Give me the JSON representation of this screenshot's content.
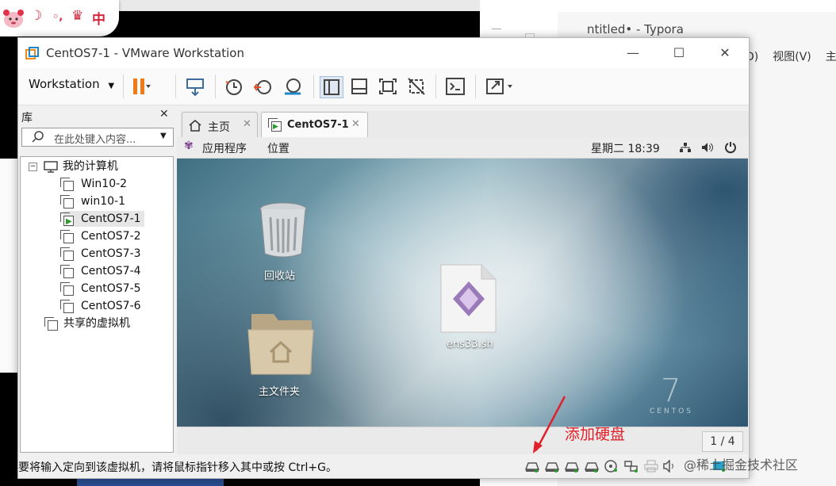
{
  "ime_bar": {
    "mode_label": "中"
  },
  "background_window": {
    "title": "ntitled• - Typora",
    "menu": [
      "D)",
      "视图(V)",
      "主题"
    ]
  },
  "window": {
    "title": "CentOS7-1 - VMware Workstation",
    "controls": {
      "minimize": "—",
      "maximize": "☐",
      "close": "✕"
    }
  },
  "toolbar": {
    "menu_label": "Workstation"
  },
  "library": {
    "title": "库",
    "close": "✕",
    "search_placeholder": "在此处键入内容...",
    "root": "我的计算机",
    "vms": [
      "Win10-2",
      "win10-1",
      "CentOS7-1",
      "CentOS7-2",
      "CentOS7-3",
      "CentOS7-4",
      "CentOS7-5",
      "CentOS7-6"
    ],
    "selected_vm": "CentOS7-1",
    "shared": "共享的虚拟机"
  },
  "tabs": [
    {
      "label": "主页",
      "close": "✕"
    },
    {
      "label": "CentOS7-1",
      "close": "✕",
      "active": true
    }
  ],
  "guest": {
    "topbar": {
      "apps": "应用程序",
      "places": "位置",
      "clock": "星期二 18:39"
    },
    "desktop_icons": [
      {
        "label": "回收站",
        "icon": "trash-icon"
      },
      {
        "label": "ens33.sh",
        "icon": "script-file-icon"
      },
      {
        "label": "主文件夹",
        "icon": "home-folder-icon"
      }
    ],
    "branding": {
      "number": "7",
      "name": "CENTOS"
    },
    "pager": "1 / 4"
  },
  "statusbar": {
    "message": "要将输入定向到该虚拟机，请将鼠标指针移入其中或按 Ctrl+G。"
  },
  "annotation": {
    "text": "添加硬盘",
    "color": "#e0202a"
  },
  "watermark": "@稀土掘金技术社区"
}
